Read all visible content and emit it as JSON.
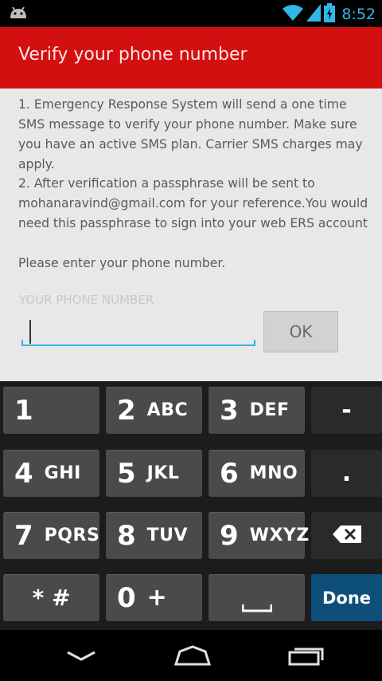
{
  "status_bar": {
    "time": "8:52",
    "icons": [
      "android-debug-icon",
      "wifi-icon",
      "cell-signal-icon",
      "battery-charging-icon"
    ],
    "accent_color": "#33b5e5"
  },
  "action_bar": {
    "title": "Verify your phone number",
    "background_color": "#d40f0f"
  },
  "content": {
    "paragraph_1": "1. Emergency Response System will send a one time SMS message to verify your phone number. Make sure you have an active SMS plan. Carrier SMS charges may apply.",
    "paragraph_2": "2. After verification a passphrase will be sent to mohanaravind@gmail.com for your reference.You would need this passphrase to sign into your web ERS account",
    "prompt": "Please enter your phone number.",
    "phone_input": {
      "placeholder": "YOUR PHONE NUMBER",
      "value": ""
    },
    "ok_label": "OK"
  },
  "keypad": {
    "rows": [
      [
        {
          "digit": "1",
          "letters": ""
        },
        {
          "digit": "2",
          "letters": "ABC"
        },
        {
          "digit": "3",
          "letters": "DEF"
        },
        {
          "side": "-"
        }
      ],
      [
        {
          "digit": "4",
          "letters": "GHI"
        },
        {
          "digit": "5",
          "letters": "JKL"
        },
        {
          "digit": "6",
          "letters": "MNO"
        },
        {
          "side": "."
        }
      ],
      [
        {
          "digit": "7",
          "letters": "PQRS"
        },
        {
          "digit": "8",
          "letters": "TUV"
        },
        {
          "digit": "9",
          "letters": "WXYZ"
        },
        {
          "side": "backspace-icon"
        }
      ],
      [
        {
          "label": "* #"
        },
        {
          "digit": "0",
          "letters": "+"
        },
        {
          "label": "space-icon"
        },
        {
          "done": "Done"
        }
      ]
    ],
    "done_color": "#0e4f7a"
  },
  "nav_bar": {
    "buttons": [
      "back-icon",
      "home-icon",
      "recent-apps-icon"
    ]
  }
}
